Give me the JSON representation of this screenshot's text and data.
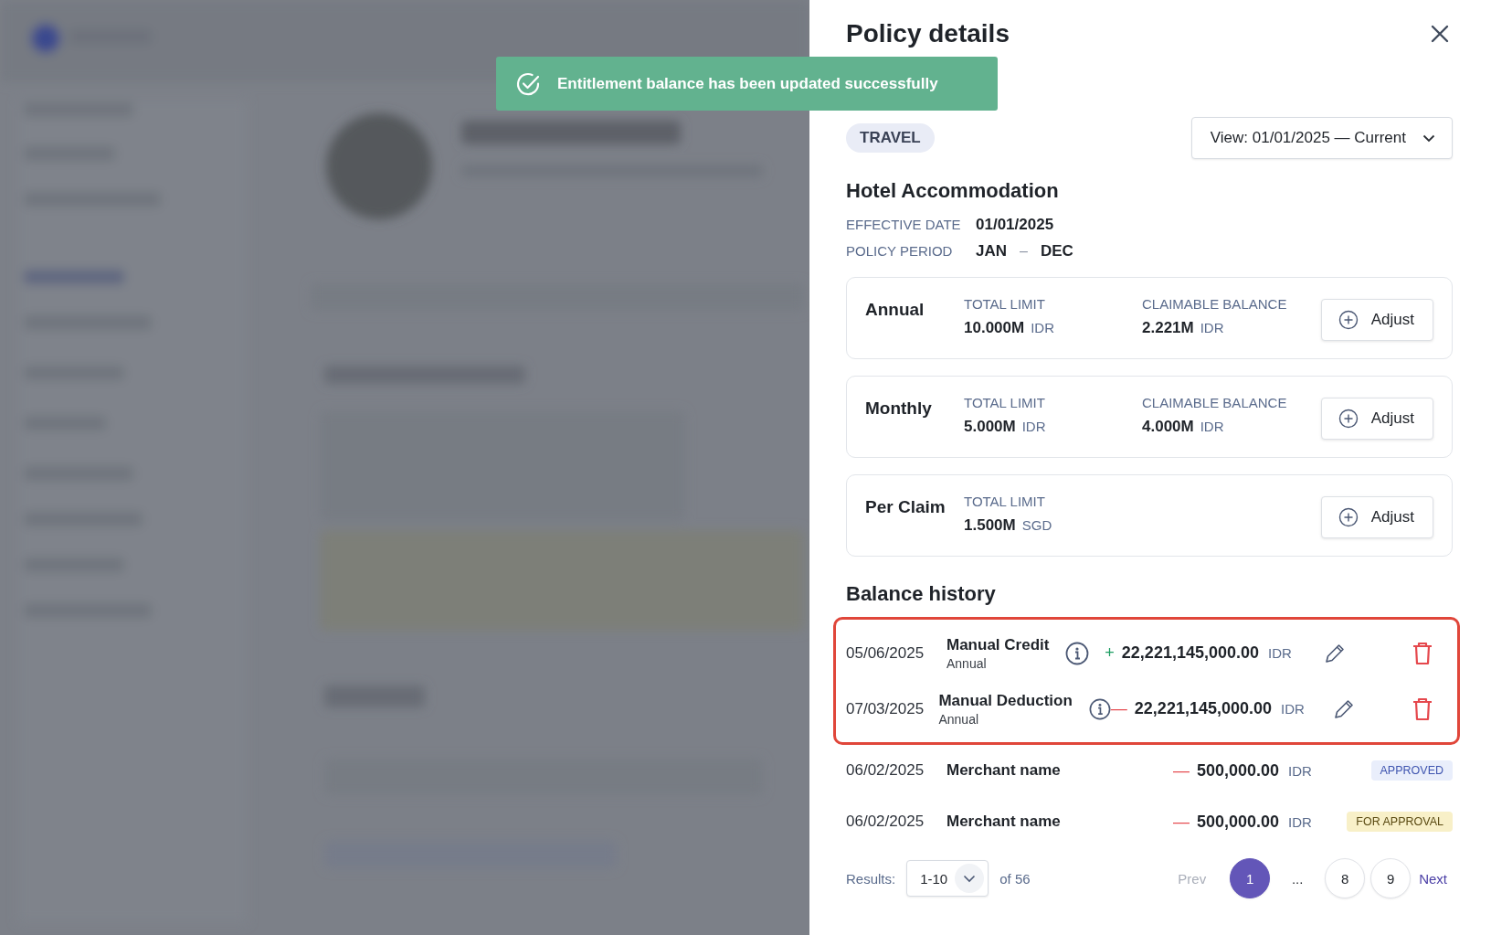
{
  "toast": {
    "message": "Entitlement balance has been updated successfully"
  },
  "panel": {
    "title": "Policy details",
    "category": "TRAVEL",
    "view_select": {
      "value": "View: 01/01/2025 — Current"
    },
    "policy_name": "Hotel Accommodation",
    "meta": [
      {
        "label": "EFFECTIVE DATE",
        "value": "01/01/2025"
      },
      {
        "label": "POLICY PERIOD",
        "value": "JAN",
        "separator": "–",
        "value_end": "DEC"
      }
    ],
    "limits": [
      {
        "name": "Annual",
        "figures": [
          {
            "label": "TOTAL LIMIT",
            "value": "10.000M",
            "currency": "IDR"
          },
          {
            "label": "CLAIMABLE BALANCE",
            "value": "2.221M",
            "currency": "IDR"
          }
        ],
        "button": "Adjust"
      },
      {
        "name": "Monthly",
        "figures": [
          {
            "label": "TOTAL LIMIT",
            "value": "5.000M",
            "currency": "IDR"
          },
          {
            "label": "CLAIMABLE BALANCE",
            "value": "4.000M",
            "currency": "IDR"
          }
        ],
        "button": "Adjust"
      },
      {
        "name": "Per Claim",
        "figures": [
          {
            "label": "TOTAL LIMIT",
            "value": "1.500M",
            "currency": "SGD"
          }
        ],
        "button": "Adjust"
      }
    ],
    "history_title": "Balance history",
    "history": [
      {
        "kind": "manual",
        "highlighted": true,
        "date": "05/06/2025",
        "title": "Manual Credit",
        "subtitle": "Annual",
        "credit": true,
        "sign": "+",
        "amount": "22,221,145,000.00",
        "currency": "IDR"
      },
      {
        "kind": "manual",
        "highlighted": true,
        "date": "07/03/2025",
        "title": "Manual Deduction",
        "subtitle": "Annual",
        "credit": false,
        "sign": "—",
        "amount": "22,221,145,000.00",
        "currency": "IDR"
      },
      {
        "kind": "claim",
        "highlighted": false,
        "date": "06/02/2025",
        "title": "Merchant name",
        "credit": false,
        "sign": "—",
        "amount": "500,000.00",
        "currency": "IDR",
        "status": {
          "label": "APPROVED",
          "kind": "approved"
        }
      },
      {
        "kind": "claim",
        "highlighted": false,
        "date": "06/02/2025",
        "title": "Merchant name",
        "credit": false,
        "sign": "—",
        "amount": "500,000.00",
        "currency": "IDR",
        "status": {
          "label": "FOR APPROVAL",
          "kind": "pending"
        }
      }
    ],
    "pagination": {
      "results_label": "Results:",
      "page_size": "1-10",
      "total": "of 56",
      "prev": {
        "label": "Prev",
        "disabled": true
      },
      "pages": [
        {
          "kind": "page",
          "label": "1",
          "selected": true
        },
        {
          "kind": "ellipsis",
          "label": "..."
        },
        {
          "kind": "page",
          "label": "8",
          "selected": false
        },
        {
          "kind": "page",
          "label": "9",
          "selected": false
        }
      ],
      "next": {
        "label": "Next",
        "disabled": false
      }
    }
  }
}
